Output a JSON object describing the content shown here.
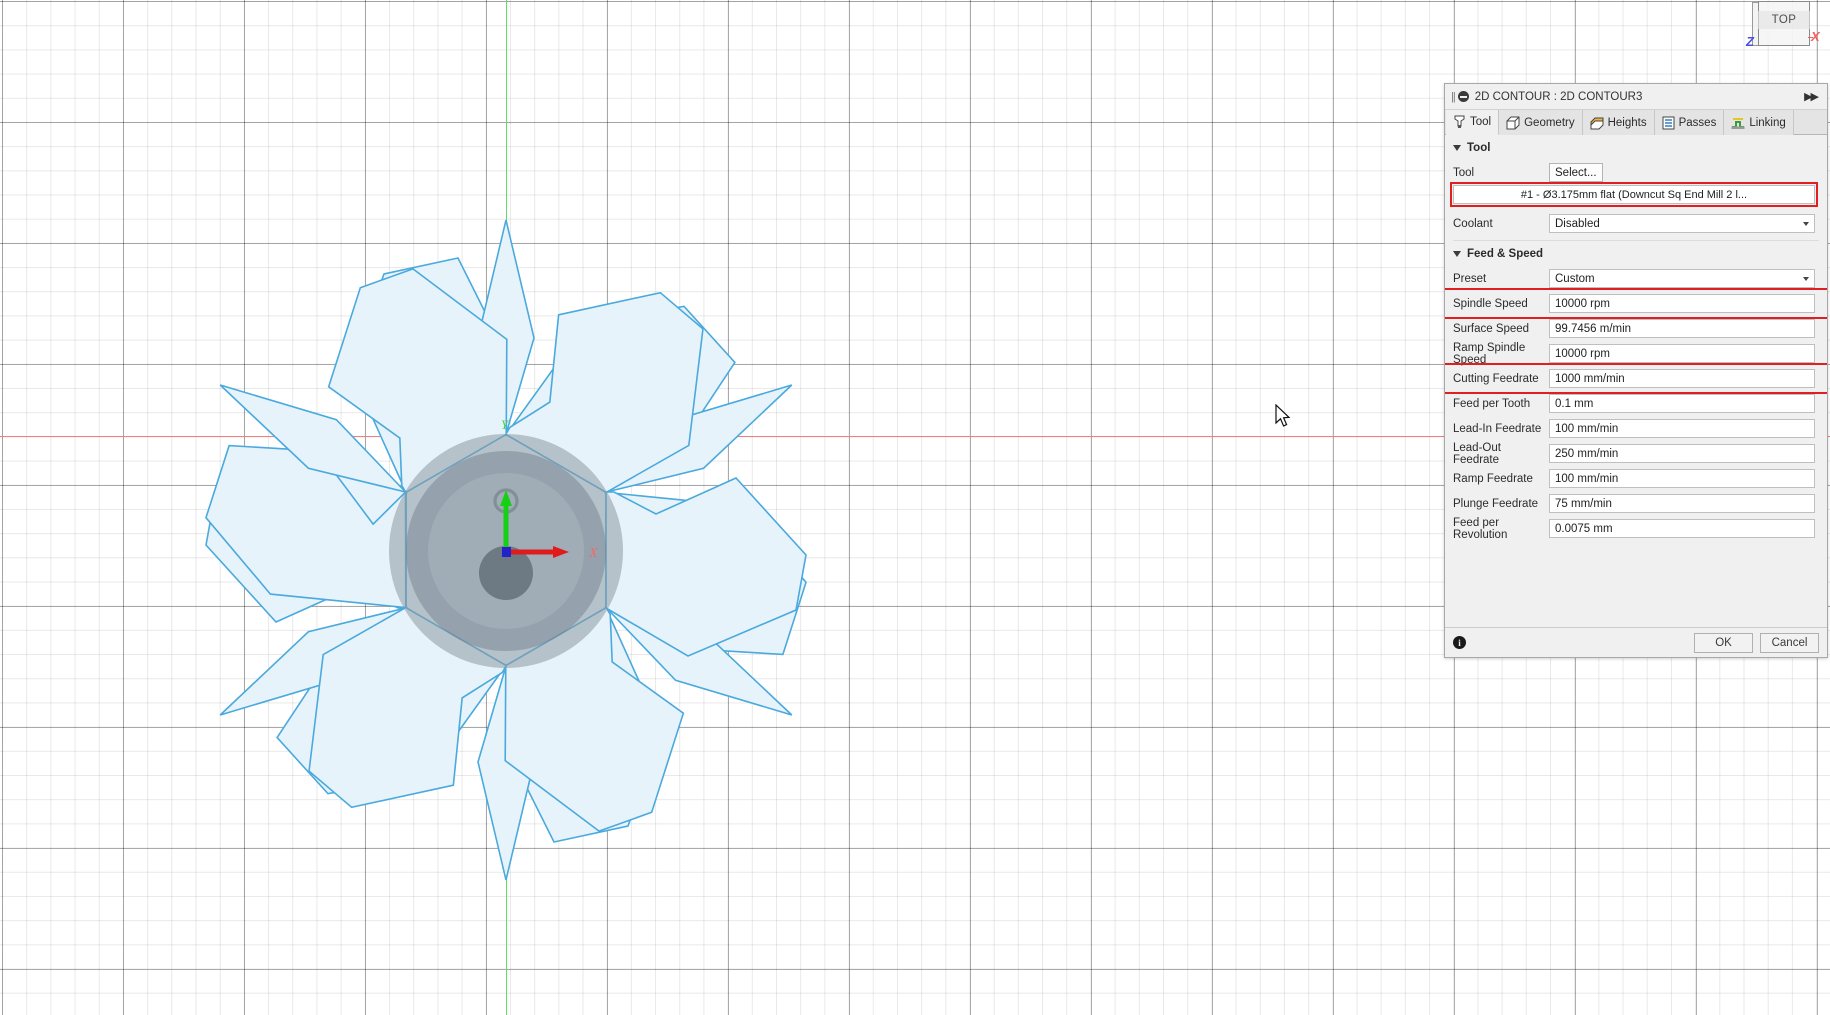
{
  "viewport": {
    "viewcube": {
      "face_label": "TOP",
      "axis_z_label": "Z",
      "axis_x_label": "X"
    },
    "origin": {
      "x_axis_label": "X",
      "y_axis_label": "Y",
      "x_axis_color": "#e01b1b",
      "y_axis_color": "#16d016"
    },
    "model": {
      "name": "snowflake-sketch",
      "fill_color": "#e7f3fb",
      "stroke_color": "#4aa9dd",
      "tool_color": "#8b99a3"
    },
    "grid": {
      "minor_color": "#e8e8e8",
      "major_color": "#b4b4b4",
      "x_axis_color": "#f08080",
      "y_axis_color": "#5ee05e"
    }
  },
  "dialog": {
    "title": "2D CONTOUR : 2D CONTOUR3",
    "expand_icon": "chevron-double-right-icon",
    "tabs": [
      {
        "label": "Tool",
        "icon": "tool-icon",
        "active": true
      },
      {
        "label": "Geometry",
        "icon": "geometry-icon",
        "active": false
      },
      {
        "label": "Heights",
        "icon": "heights-icon",
        "active": false
      },
      {
        "label": "Passes",
        "icon": "passes-icon",
        "active": false
      },
      {
        "label": "Linking",
        "icon": "linking-icon",
        "active": false
      }
    ],
    "sections": [
      {
        "title": "Tool",
        "rows": [
          {
            "label": "Tool",
            "type": "button",
            "value": "Select...",
            "highlight": false
          },
          {
            "label": "",
            "type": "toolinfo",
            "value": "#1 - Ø3.175mm flat (Downcut Sq End Mill 2 l...",
            "highlight": true
          },
          {
            "label": "Coolant",
            "type": "select",
            "value": "Disabled",
            "highlight": false
          }
        ]
      },
      {
        "title": "Feed & Speed",
        "rows": [
          {
            "label": "Preset",
            "type": "select",
            "value": "Custom",
            "highlight": false
          },
          {
            "label": "Spindle Speed",
            "type": "text",
            "value": "10000 rpm",
            "highlight": true
          },
          {
            "label": "Surface Speed",
            "type": "text",
            "value": "99.7456 m/min",
            "highlight": false
          },
          {
            "label": "Ramp Spindle Speed",
            "type": "text",
            "value": "10000 rpm",
            "highlight": false
          },
          {
            "label": "Cutting Feedrate",
            "type": "text",
            "value": "1000 mm/min",
            "highlight": true
          },
          {
            "label": "Feed per Tooth",
            "type": "text",
            "value": "0.1 mm",
            "highlight": false
          },
          {
            "label": "Lead-In Feedrate",
            "type": "text",
            "value": "100 mm/min",
            "highlight": false
          },
          {
            "label": "Lead-Out Feedrate",
            "type": "text",
            "value": "250 mm/min",
            "highlight": false
          },
          {
            "label": "Ramp Feedrate",
            "type": "text",
            "value": "100 mm/min",
            "highlight": false
          },
          {
            "label": "Plunge Feedrate",
            "type": "text",
            "value": "75 mm/min",
            "highlight": false
          },
          {
            "label": "Feed per Revolution",
            "type": "text",
            "value": "0.0075 mm",
            "highlight": false
          }
        ]
      }
    ],
    "footer": {
      "info_label": "i",
      "ok_label": "OK",
      "cancel_label": "Cancel"
    },
    "highlight_color": "#e02020"
  }
}
